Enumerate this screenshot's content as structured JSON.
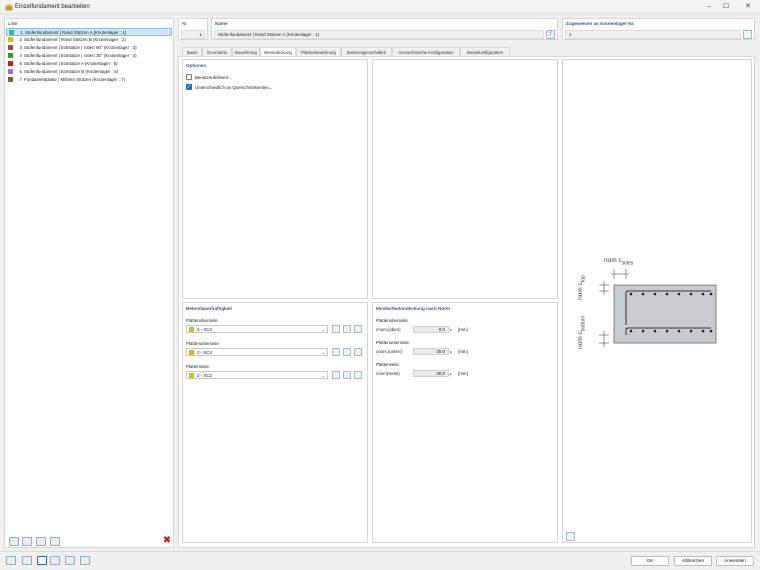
{
  "window": {
    "title": "Einzelfundament bearbeiten",
    "controls": {
      "minimize": "–",
      "maximize": "☐",
      "close": "✕"
    }
  },
  "list": {
    "header": "Liste",
    "items": [
      {
        "num": "1",
        "label": "Stufenfundament | Rand Stützen A (Knotenlager : 1)",
        "color": "#2bb5b5",
        "selected": true
      },
      {
        "num": "2",
        "label": "Stufenfundament | Rand Stützen B (Knotenlager : 2)",
        "color": "#e8b800"
      },
      {
        "num": "3",
        "label": "Stufenfundament | Eckstütze | rotiert 60° (Knotenlager : 3)",
        "color": "#a0522d"
      },
      {
        "num": "4",
        "label": "Stufenfundament | Eckstütze | rotiert 30° (Knotenlager : 4)",
        "color": "#3aa02a"
      },
      {
        "num": "5",
        "label": "Stufenfundament | Eckstütze A (Knotenlager : 5)",
        "color": "#d01818"
      },
      {
        "num": "6",
        "label": "Stufenfundament | Eckstütze B (Knotenlager : 6)",
        "color": "#a070d8"
      },
      {
        "num": "7",
        "label": "Fundamentplatte | Mittlere Stützen (Knotenlager : 7)",
        "color": "#8b5a2b"
      }
    ]
  },
  "header_fields": {
    "nr_label": "Nr.",
    "nr_value": "1",
    "name_label": "Name",
    "name_value": "Stufenfundament | Rand Stützen A (Knotenlager : 1)",
    "assigned_label": "Zugewiesen an Knotenlager Nr.",
    "assigned_value": "1"
  },
  "tabs": [
    {
      "label": "Basis"
    },
    {
      "label": "Geometrie"
    },
    {
      "label": "Bewehrung"
    },
    {
      "label": "Betondeckung",
      "active": true
    },
    {
      "label": "Plattenbewehrung"
    },
    {
      "label": "Bodeneigenschaften"
    },
    {
      "label": "Geotechnische Konfiguration"
    },
    {
      "label": "Betonkonfiguration"
    }
  ],
  "options": {
    "header": "Optionen",
    "user_defined": {
      "label": "Benutzerdefiniert...",
      "checked": false
    },
    "different_sides": {
      "label": "Unterschiedlich an Querschnittsseiten...",
      "checked": true
    }
  },
  "exposure": {
    "header": "Betondauerhaftigkeit",
    "rows": [
      {
        "label": "Plattenoberseite",
        "value": "2 - XC2"
      },
      {
        "label": "Plattenunterseite",
        "value": "2 - XC2"
      },
      {
        "label": "Plattenseite",
        "value": "2 - XC2"
      }
    ],
    "swatch_color": "#e8b800"
  },
  "min_cover": {
    "header": "Mindestbetondeckung nach Norm",
    "rows": [
      {
        "section": "Plattenoberseite",
        "param": "cnom,(oben)",
        "value": "0.0",
        "unit": "[mm]"
      },
      {
        "section": "Plattenunterseite",
        "param": "cnom,(unten)",
        "value": "30.0",
        "unit": "[mm]"
      },
      {
        "section": "Plattenseite",
        "param": "cnom(Seite)",
        "value": "30.0",
        "unit": "[mm]"
      }
    ]
  },
  "diagram": {
    "label_sides": "nom c",
    "label_sides_sub": "sides",
    "label_top": "nom c",
    "label_top_sub": "top",
    "label_bottom": "nom c",
    "label_bottom_sub": "bottom"
  },
  "buttons": {
    "ok": "OK",
    "cancel": "Abbrechen",
    "apply": "Anwenden"
  }
}
